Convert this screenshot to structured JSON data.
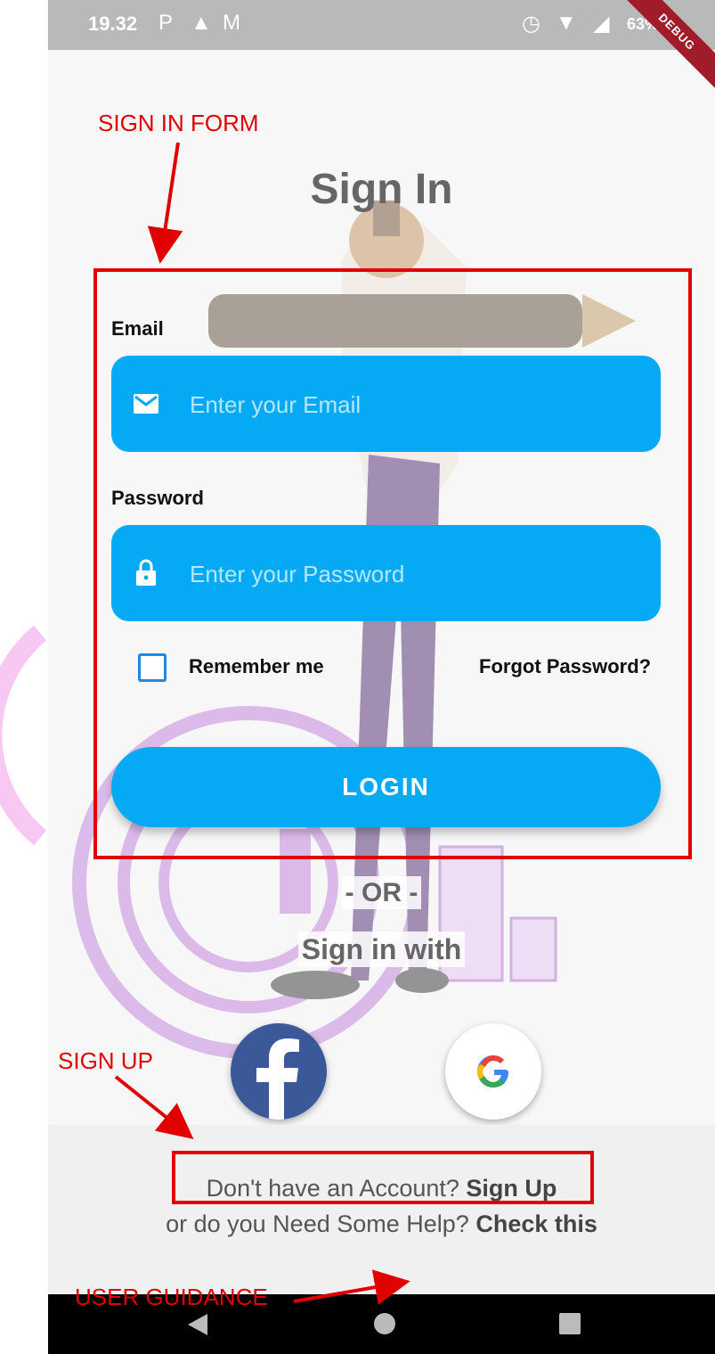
{
  "status_bar": {
    "time": "19.32",
    "battery": "63%",
    "debug_banner": "DEBUG"
  },
  "page_title": "Sign In",
  "form": {
    "email_label": "Email",
    "email_placeholder": "Enter your Email",
    "password_label": "Password",
    "password_placeholder": "Enter your Password",
    "remember_label": "Remember me",
    "forgot_label": "Forgot Password?",
    "login_label": "LOGIN"
  },
  "social": {
    "or_text": "- OR -",
    "sign_in_with": "Sign in with",
    "facebook_icon": "facebook-icon",
    "google_icon": "google-icon"
  },
  "footer": {
    "no_account_text": "Don't have an Account? ",
    "signup_link": "Sign Up",
    "help_text": "or do you Need Some Help? ",
    "help_link": "Check this"
  },
  "annotations": {
    "sign_in_form": "SIGN IN FORM",
    "sign_up": "SIGN UP",
    "user_guidance": "USER GUIDANCE"
  },
  "colors": {
    "accent": "#06a9f4",
    "annotation": "#e00000",
    "facebook": "#3b5998"
  }
}
